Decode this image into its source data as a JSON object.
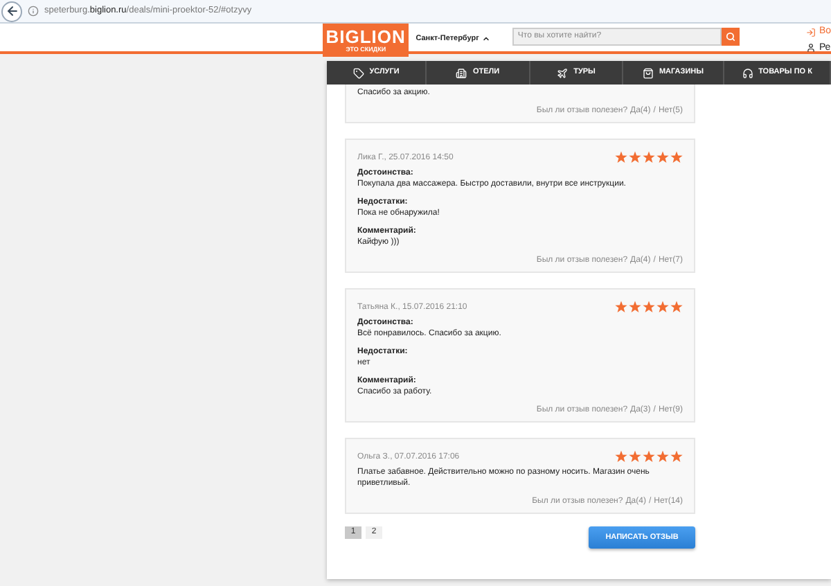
{
  "browser": {
    "url": "speterburg.**biglion.ru**/deals/mini-proektor-52/#otzyvy"
  },
  "header": {
    "logo": "BIGLION",
    "tagline": "ЭТО СКИДКИ",
    "city": "Санкт-Петербург",
    "search": {
      "placeholder": "Что вы хотите найти?"
    },
    "login": "Во",
    "register": "Ре"
  },
  "nav": [
    {
      "label": "УСЛУГИ",
      "kind": "tag"
    },
    {
      "label": "ОТЕЛИ",
      "kind": "hotel"
    },
    {
      "label": "ТУРЫ",
      "kind": "plane"
    },
    {
      "label": "МАГАЗИНЫ",
      "kind": "bag"
    },
    {
      "label": "ТОВАРЫ ПО К",
      "kind": "headphones"
    }
  ],
  "reviews": [
    {
      "sections": [
        {
          "text": "Спасибо за акцию."
        }
      ],
      "helpful": {
        "question": "Был ли отзыв полезен?",
        "yes": "Да(4)",
        "divider": "/",
        "no": "Нет(5)"
      }
    },
    {
      "author": "Лика Г., 25.07.2016 14:50",
      "stars": 5,
      "sections": [
        {
          "heading": "Достоинства:",
          "text": "Покупала два массажера. Быстро доставили, внутри все инструкции."
        },
        {
          "heading": "Недостатки:",
          "text": "Пока не обнаружила!"
        },
        {
          "heading": "Комментарий:",
          "text": "Кайфую )))"
        }
      ],
      "helpful": {
        "question": "Был ли отзыв полезен?",
        "yes": "Да(4)",
        "divider": "/",
        "no": "Нет(7)"
      }
    },
    {
      "author": "Татьяна К., 15.07.2016 21:10",
      "stars": 5,
      "sections": [
        {
          "heading": "Достоинства:",
          "text": "Всё понравилось. Спасибо за акцию."
        },
        {
          "heading": "Недостатки:",
          "text": "нет"
        },
        {
          "heading": "Комментарий:",
          "text": "Спасибо за работу."
        }
      ],
      "helpful": {
        "question": "Был ли отзыв полезен?",
        "yes": "Да(3)",
        "divider": "/",
        "no": "Нет(9)"
      }
    },
    {
      "author": "Ольга З., 07.07.2016 17:06",
      "stars": 5,
      "sections": [
        {
          "text": "Платье забавное. Действительно можно по разному носить. Магазин очень приветливый."
        }
      ],
      "helpful": {
        "question": "Был ли отзыв полезен?",
        "yes": "Да(4)",
        "divider": "/",
        "no": "Нет(14)"
      }
    }
  ],
  "pages": [
    {
      "label": "1",
      "selected": true
    },
    {
      "label": "2",
      "selected": false
    }
  ],
  "write_button": "НАПИСАТЬ ОТЗЫВ"
}
